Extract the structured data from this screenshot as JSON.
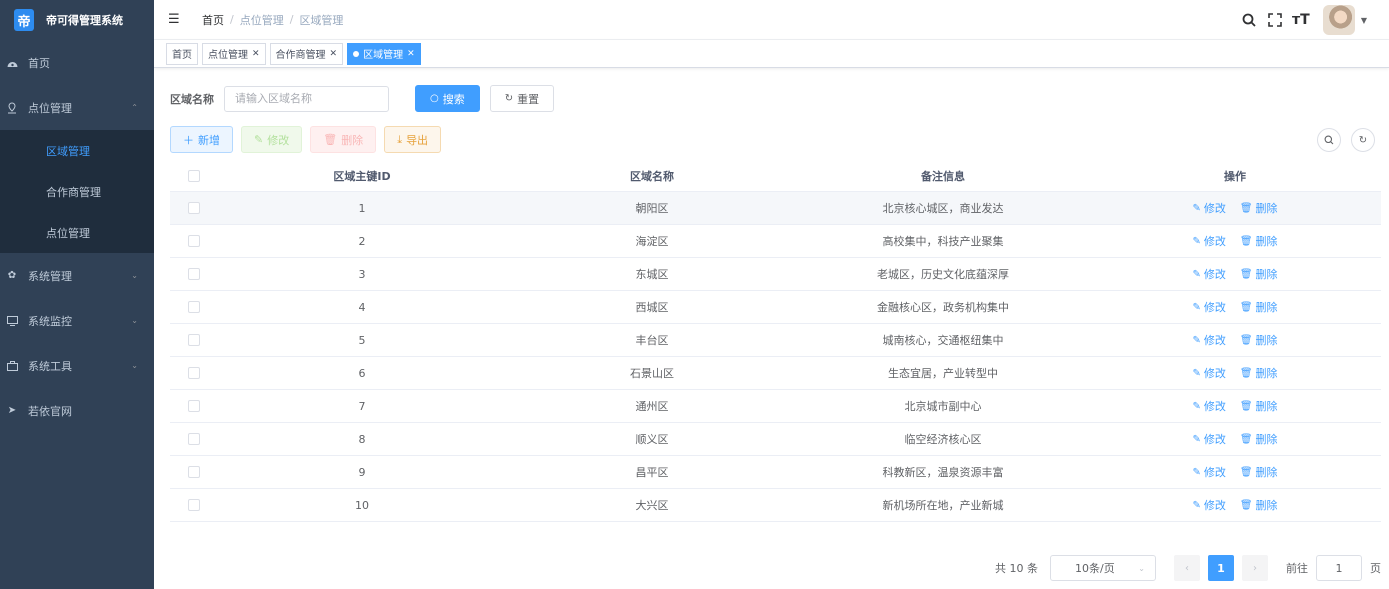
{
  "brand": {
    "logo_text": "帝",
    "title": "帝可得管理系统"
  },
  "sidebar": {
    "items": [
      {
        "label": "首页",
        "icon": "dashboard-icon"
      },
      {
        "label": "点位管理",
        "icon": "location-icon",
        "expanded": true,
        "children": [
          "区域管理",
          "合作商管理",
          "点位管理"
        ],
        "active_child": "区域管理"
      },
      {
        "label": "系统管理",
        "icon": "gear-icon"
      },
      {
        "label": "系统监控",
        "icon": "monitor-icon"
      },
      {
        "label": "系统工具",
        "icon": "toolbox-icon"
      },
      {
        "label": "若依官网",
        "icon": "send-icon"
      }
    ]
  },
  "header": {
    "breadcrumb": [
      "首页",
      "点位管理",
      "区域管理"
    ],
    "icons": [
      "search-icon",
      "fullscreen-icon",
      "font-size-icon"
    ]
  },
  "tags": [
    {
      "label": "首页",
      "closable": false
    },
    {
      "label": "点位管理",
      "closable": true
    },
    {
      "label": "合作商管理",
      "closable": true
    },
    {
      "label": "区域管理",
      "closable": true,
      "active": true
    }
  ],
  "search": {
    "label": "区域名称",
    "placeholder": "请输入区域名称",
    "search_label": "搜索",
    "reset_label": "重置"
  },
  "toolbar": {
    "add_label": "新增",
    "edit_label": "修改",
    "delete_label": "删除",
    "export_label": "导出"
  },
  "table": {
    "columns": [
      "区域主键ID",
      "区域名称",
      "备注信息",
      "操作"
    ],
    "edit_label": "修改",
    "delete_label": "删除",
    "rows": [
      {
        "id": "1",
        "name": "朝阳区",
        "remark": "北京核心城区，商业发达"
      },
      {
        "id": "2",
        "name": "海淀区",
        "remark": "高校集中，科技产业聚集"
      },
      {
        "id": "3",
        "name": "东城区",
        "remark": "老城区，历史文化底蕴深厚"
      },
      {
        "id": "4",
        "name": "西城区",
        "remark": "金融核心区，政务机构集中"
      },
      {
        "id": "5",
        "name": "丰台区",
        "remark": "城南核心，交通枢纽集中"
      },
      {
        "id": "6",
        "name": "石景山区",
        "remark": "生态宜居，产业转型中"
      },
      {
        "id": "7",
        "name": "通州区",
        "remark": "北京城市副中心"
      },
      {
        "id": "8",
        "name": "顺义区",
        "remark": "临空经济核心区"
      },
      {
        "id": "9",
        "name": "昌平区",
        "remark": "科教新区，温泉资源丰富"
      },
      {
        "id": "10",
        "name": "大兴区",
        "remark": "新机场所在地，产业新城"
      }
    ]
  },
  "pagination": {
    "total": "共 10 条",
    "page_size": "10条/页",
    "current_page": "1",
    "goto_label": "前往",
    "goto_value": "1",
    "page_unit": "页"
  },
  "colors": {
    "primary": "#409eff",
    "sidebar_bg": "#304156",
    "submenu_bg": "#1f2d3d"
  }
}
